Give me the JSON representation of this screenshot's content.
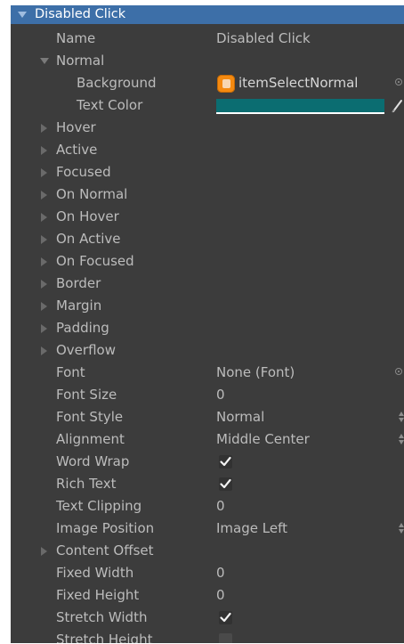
{
  "header": {
    "title": "Disabled Click"
  },
  "name_row": {
    "label": "Name",
    "value": "Disabled Click"
  },
  "normal": {
    "label": "Normal",
    "background": {
      "label": "Background",
      "value": "itemSelectNormal",
      "icon": "texture-icon"
    },
    "text_color": {
      "label": "Text Color",
      "color": "#0b6d71"
    }
  },
  "foldouts": [
    {
      "label": "Hover"
    },
    {
      "label": "Active"
    },
    {
      "label": "Focused"
    },
    {
      "label": "On Normal"
    },
    {
      "label": "On Hover"
    },
    {
      "label": "On Active"
    },
    {
      "label": "On Focused"
    },
    {
      "label": "Border"
    },
    {
      "label": "Margin"
    },
    {
      "label": "Padding"
    },
    {
      "label": "Overflow"
    }
  ],
  "font": {
    "label": "Font",
    "value": "None (Font)"
  },
  "font_size": {
    "label": "Font Size",
    "value": "0"
  },
  "font_style": {
    "label": "Font Style",
    "value": "Normal"
  },
  "alignment": {
    "label": "Alignment",
    "value": "Middle Center"
  },
  "word_wrap": {
    "label": "Word Wrap",
    "checked": true
  },
  "rich_text": {
    "label": "Rich Text",
    "checked": true
  },
  "text_clipping": {
    "label": "Text Clipping",
    "value": "0"
  },
  "image_position": {
    "label": "Image Position",
    "value": "Image Left"
  },
  "content_offset": {
    "label": "Content Offset"
  },
  "fixed_width": {
    "label": "Fixed Width",
    "value": "0"
  },
  "fixed_height": {
    "label": "Fixed Height",
    "value": "0"
  },
  "stretch_width": {
    "label": "Stretch Width",
    "checked": true
  },
  "stretch_height": {
    "label": "Stretch Height",
    "checked": false
  },
  "colors": {
    "panel": "#3c3c3c",
    "header": "#3d6fa8",
    "text": "#bcbcbc",
    "accent_icon": "#f58a10"
  }
}
